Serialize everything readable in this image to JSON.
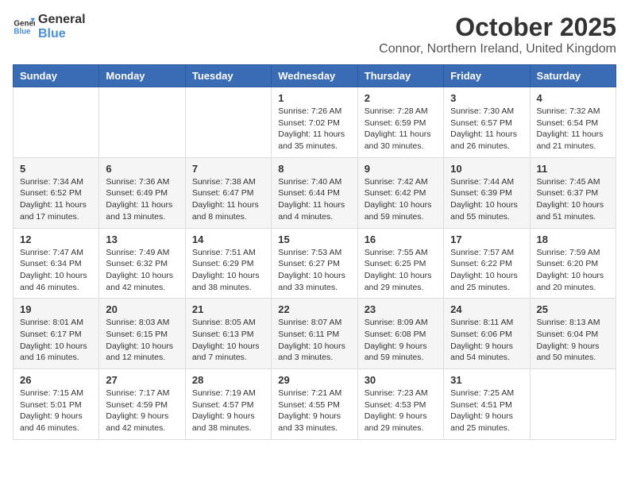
{
  "header": {
    "logo_general": "General",
    "logo_blue": "Blue",
    "title": "October 2025",
    "subtitle": "Connor, Northern Ireland, United Kingdom"
  },
  "days_of_week": [
    "Sunday",
    "Monday",
    "Tuesday",
    "Wednesday",
    "Thursday",
    "Friday",
    "Saturday"
  ],
  "weeks": [
    [
      {
        "day": "",
        "info": ""
      },
      {
        "day": "",
        "info": ""
      },
      {
        "day": "",
        "info": ""
      },
      {
        "day": "1",
        "info": "Sunrise: 7:26 AM\nSunset: 7:02 PM\nDaylight: 11 hours\nand 35 minutes."
      },
      {
        "day": "2",
        "info": "Sunrise: 7:28 AM\nSunset: 6:59 PM\nDaylight: 11 hours\nand 30 minutes."
      },
      {
        "day": "3",
        "info": "Sunrise: 7:30 AM\nSunset: 6:57 PM\nDaylight: 11 hours\nand 26 minutes."
      },
      {
        "day": "4",
        "info": "Sunrise: 7:32 AM\nSunset: 6:54 PM\nDaylight: 11 hours\nand 21 minutes."
      }
    ],
    [
      {
        "day": "5",
        "info": "Sunrise: 7:34 AM\nSunset: 6:52 PM\nDaylight: 11 hours\nand 17 minutes."
      },
      {
        "day": "6",
        "info": "Sunrise: 7:36 AM\nSunset: 6:49 PM\nDaylight: 11 hours\nand 13 minutes."
      },
      {
        "day": "7",
        "info": "Sunrise: 7:38 AM\nSunset: 6:47 PM\nDaylight: 11 hours\nand 8 minutes."
      },
      {
        "day": "8",
        "info": "Sunrise: 7:40 AM\nSunset: 6:44 PM\nDaylight: 11 hours\nand 4 minutes."
      },
      {
        "day": "9",
        "info": "Sunrise: 7:42 AM\nSunset: 6:42 PM\nDaylight: 10 hours\nand 59 minutes."
      },
      {
        "day": "10",
        "info": "Sunrise: 7:44 AM\nSunset: 6:39 PM\nDaylight: 10 hours\nand 55 minutes."
      },
      {
        "day": "11",
        "info": "Sunrise: 7:45 AM\nSunset: 6:37 PM\nDaylight: 10 hours\nand 51 minutes."
      }
    ],
    [
      {
        "day": "12",
        "info": "Sunrise: 7:47 AM\nSunset: 6:34 PM\nDaylight: 10 hours\nand 46 minutes."
      },
      {
        "day": "13",
        "info": "Sunrise: 7:49 AM\nSunset: 6:32 PM\nDaylight: 10 hours\nand 42 minutes."
      },
      {
        "day": "14",
        "info": "Sunrise: 7:51 AM\nSunset: 6:29 PM\nDaylight: 10 hours\nand 38 minutes."
      },
      {
        "day": "15",
        "info": "Sunrise: 7:53 AM\nSunset: 6:27 PM\nDaylight: 10 hours\nand 33 minutes."
      },
      {
        "day": "16",
        "info": "Sunrise: 7:55 AM\nSunset: 6:25 PM\nDaylight: 10 hours\nand 29 minutes."
      },
      {
        "day": "17",
        "info": "Sunrise: 7:57 AM\nSunset: 6:22 PM\nDaylight: 10 hours\nand 25 minutes."
      },
      {
        "day": "18",
        "info": "Sunrise: 7:59 AM\nSunset: 6:20 PM\nDaylight: 10 hours\nand 20 minutes."
      }
    ],
    [
      {
        "day": "19",
        "info": "Sunrise: 8:01 AM\nSunset: 6:17 PM\nDaylight: 10 hours\nand 16 minutes."
      },
      {
        "day": "20",
        "info": "Sunrise: 8:03 AM\nSunset: 6:15 PM\nDaylight: 10 hours\nand 12 minutes."
      },
      {
        "day": "21",
        "info": "Sunrise: 8:05 AM\nSunset: 6:13 PM\nDaylight: 10 hours\nand 7 minutes."
      },
      {
        "day": "22",
        "info": "Sunrise: 8:07 AM\nSunset: 6:11 PM\nDaylight: 10 hours\nand 3 minutes."
      },
      {
        "day": "23",
        "info": "Sunrise: 8:09 AM\nSunset: 6:08 PM\nDaylight: 9 hours\nand 59 minutes."
      },
      {
        "day": "24",
        "info": "Sunrise: 8:11 AM\nSunset: 6:06 PM\nDaylight: 9 hours\nand 54 minutes."
      },
      {
        "day": "25",
        "info": "Sunrise: 8:13 AM\nSunset: 6:04 PM\nDaylight: 9 hours\nand 50 minutes."
      }
    ],
    [
      {
        "day": "26",
        "info": "Sunrise: 7:15 AM\nSunset: 5:01 PM\nDaylight: 9 hours\nand 46 minutes."
      },
      {
        "day": "27",
        "info": "Sunrise: 7:17 AM\nSunset: 4:59 PM\nDaylight: 9 hours\nand 42 minutes."
      },
      {
        "day": "28",
        "info": "Sunrise: 7:19 AM\nSunset: 4:57 PM\nDaylight: 9 hours\nand 38 minutes."
      },
      {
        "day": "29",
        "info": "Sunrise: 7:21 AM\nSunset: 4:55 PM\nDaylight: 9 hours\nand 33 minutes."
      },
      {
        "day": "30",
        "info": "Sunrise: 7:23 AM\nSunset: 4:53 PM\nDaylight: 9 hours\nand 29 minutes."
      },
      {
        "day": "31",
        "info": "Sunrise: 7:25 AM\nSunset: 4:51 PM\nDaylight: 9 hours\nand 25 minutes."
      },
      {
        "day": "",
        "info": ""
      }
    ]
  ]
}
